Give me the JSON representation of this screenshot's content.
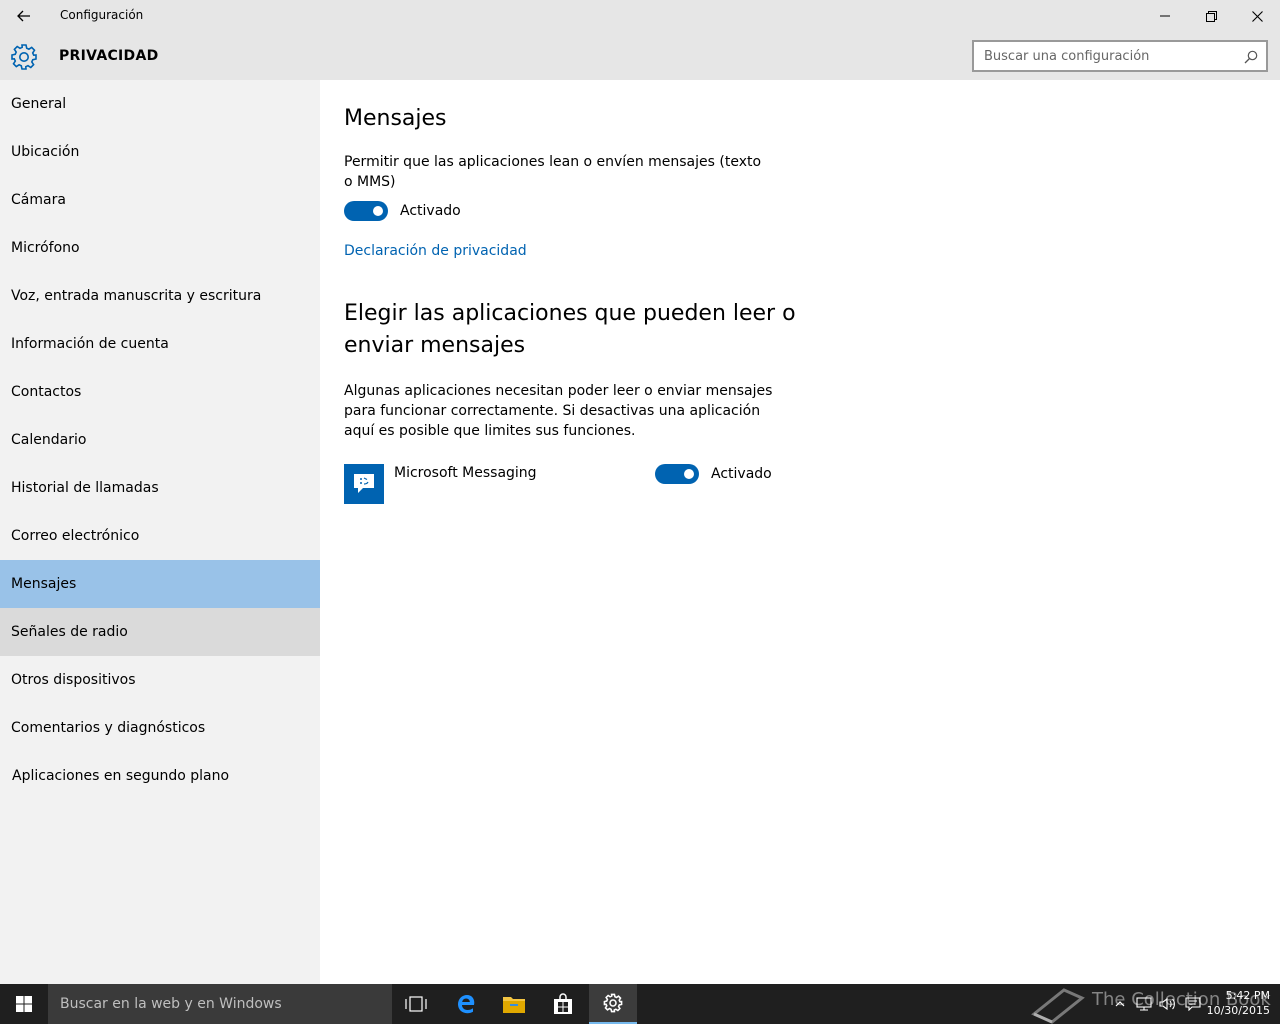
{
  "window": {
    "title": "Configuración",
    "section": "PRIVACIDAD",
    "search_placeholder": "Buscar una configuración"
  },
  "sidebar": {
    "items": [
      {
        "label": "General"
      },
      {
        "label": "Ubicación"
      },
      {
        "label": "Cámara"
      },
      {
        "label": "Micrófono"
      },
      {
        "label": "Voz, entrada manuscrita y escritura"
      },
      {
        "label": "Información de cuenta"
      },
      {
        "label": "Contactos"
      },
      {
        "label": "Calendario"
      },
      {
        "label": "Historial de llamadas"
      },
      {
        "label": "Correo electrónico"
      },
      {
        "label": "Mensajes"
      },
      {
        "label": "Señales de radio"
      },
      {
        "label": "Otros dispositivos"
      },
      {
        "label": "Comentarios y diagnósticos"
      },
      {
        "label": "Aplicaciones en segundo plano"
      }
    ],
    "selected": "Mensajes"
  },
  "main": {
    "heading": "Mensajes",
    "permission_text": "Permitir que las aplicaciones lean o envíen mensajes (texto o MMS)",
    "toggle_label": "Activado",
    "privacy_link": "Declaración de privacidad",
    "apps_heading": "Elegir las aplicaciones que pueden leer o enviar mensajes",
    "apps_description": "Algunas aplicaciones necesitan poder leer o enviar mensajes para funcionar correctamente. Si desactivas una aplicación aquí es posible que limites sus funciones.",
    "apps": [
      {
        "name": "Microsoft Messaging",
        "toggle_label": "Activado"
      }
    ]
  },
  "taskbar": {
    "search_text": "Buscar en la web y en Windows",
    "time": "5:42 PM",
    "date": "10/30/2015",
    "watermark": "The Collection Book"
  },
  "colors": {
    "accent": "#0063b1",
    "selected_nav": "#99c2e8",
    "hover_nav": "#dadada"
  }
}
